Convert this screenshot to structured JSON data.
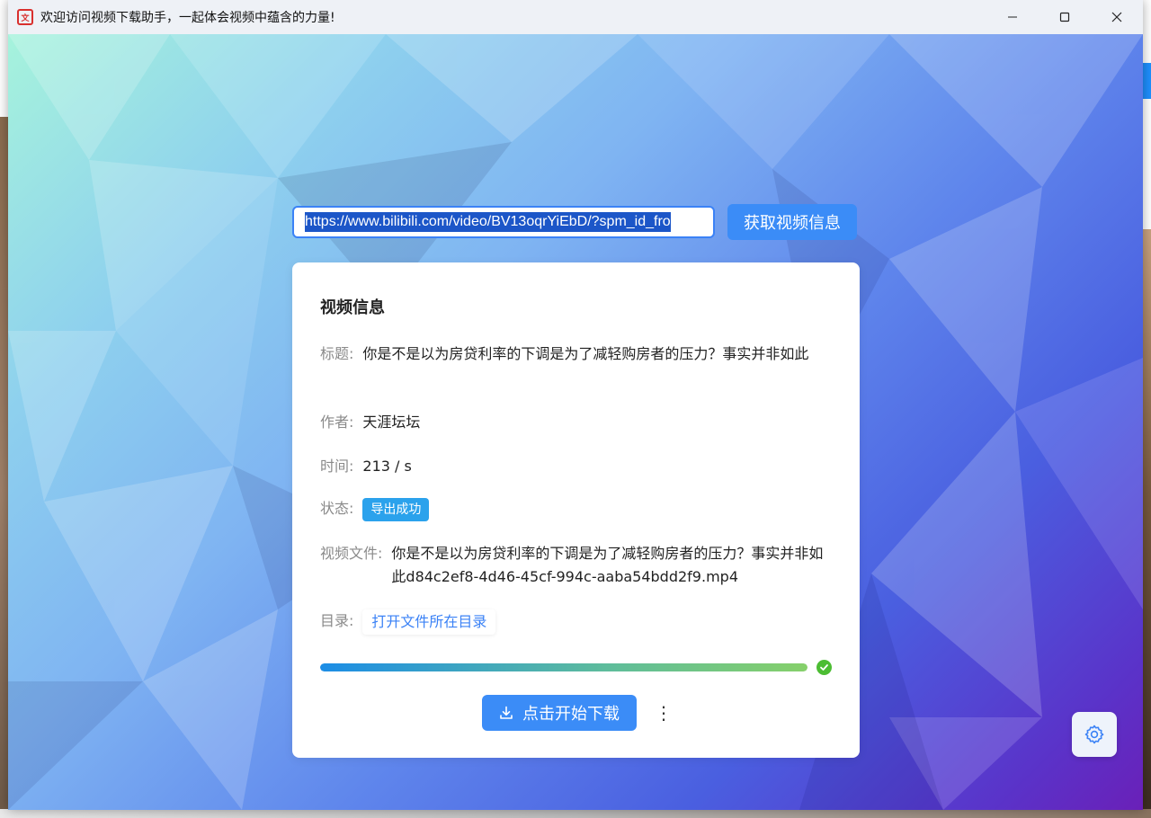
{
  "window": {
    "title": "欢迎访问视频下载助手，一起体会视频中蕴含的力量!",
    "app_icon_text": "文"
  },
  "url_bar": {
    "value": "https://www.bilibili.com/video/BV13oqrYiEbD/?spm_id_fro",
    "fetch_label": "获取视频信息"
  },
  "card": {
    "title": "视频信息",
    "title_label": "标题:",
    "title_value": "你是不是以为房贷利率的下调是为了减轻购房者的压力？事实并非如此",
    "author_label": "作者:",
    "author_value": "天涯坛坛",
    "time_label": "时间:",
    "time_value": "213 / s",
    "status_label": "状态:",
    "status_value": "导出成功",
    "file_label": "视频文件:",
    "file_value": "你是不是以为房贷利率的下调是为了减轻购房者的压力？事实并非如此d84c2ef8-4d46-45cf-994c-aaba54bdd2f9.mp4",
    "dir_label": "目录:",
    "dir_link": "打开文件所在目录",
    "progress": 1.0,
    "download_label": "点击开始下载",
    "more_label": "⋮"
  },
  "icons": {
    "minimize": "minimize-icon",
    "maximize": "maximize-icon",
    "close": "close-icon",
    "download": "download-icon",
    "check": "check-circle-icon",
    "settings": "gear-icon",
    "more": "more-vertical-icon"
  },
  "colors": {
    "accent": "#3b8cf7",
    "badge": "#2ba2ec",
    "success": "#4cbd33"
  }
}
